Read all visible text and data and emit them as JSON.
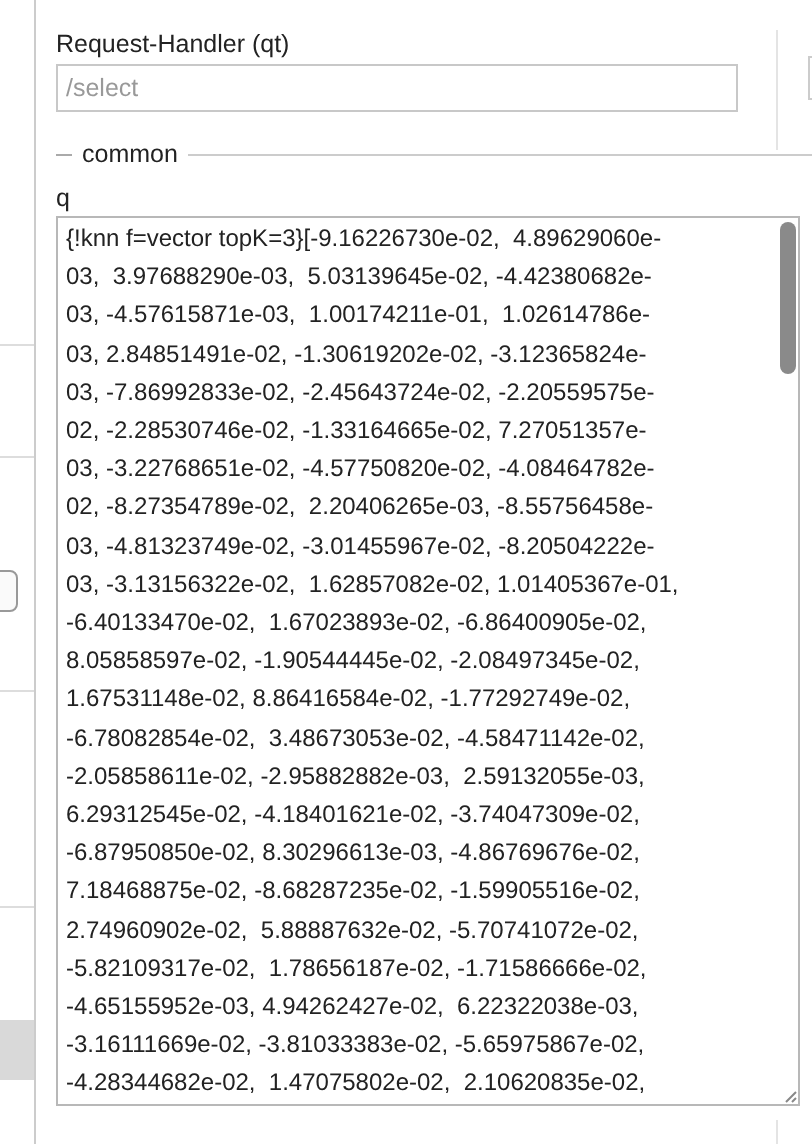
{
  "request_handler": {
    "label": "Request-Handler (qt)",
    "placeholder": "/select"
  },
  "section": {
    "title": "common"
  },
  "q": {
    "label": "q",
    "lines": [
      "{!knn f=vector topK=3}[-9.16226730e-02,  4.89629060e-",
      "03,  3.97688290e-03,  5.03139645e-02, -4.42380682e-",
      "03, -4.57615871e-03,  1.00174211e-01,  1.02614786e-",
      "03, 2.84851491e-02, -1.30619202e-02, -3.12365824e-",
      "03, -7.86992833e-02, -2.45643724e-02, -2.20559575e-",
      "02, -2.28530746e-02, -1.33164665e-02, 7.27051357e-",
      "03, -3.22768651e-02, -4.57750820e-02, -4.08464782e-",
      "02, -8.27354789e-02,  2.20406265e-03, -8.55756458e-",
      "03, -4.81323749e-02, -3.01455967e-02, -8.20504222e-",
      "03, -3.13156322e-02,  1.62857082e-02, 1.01405367e-01,",
      "-6.40133470e-02,  1.67023893e-02, -6.86400905e-02,",
      "8.05858597e-02, -1.90544445e-02, -2.08497345e-02,",
      "1.67531148e-02, 8.86416584e-02, -1.77292749e-02,",
      "-6.78082854e-02,  3.48673053e-02, -4.58471142e-02,",
      "-2.05858611e-02, -2.95882882e-03,  2.59132055e-03,",
      "6.29312545e-02, -4.18401621e-02, -3.74047309e-02,",
      "-6.87950850e-02, 8.30296613e-03, -4.86769676e-02,",
      "7.18468875e-02, -8.68287235e-02, -1.59905516e-02,",
      "2.74960902e-02,  5.88887632e-02, -5.70741072e-02,",
      "-5.82109317e-02,  1.78656187e-02, -1.71586666e-02,",
      "-4.65155952e-03, 4.94262427e-02,  6.22322038e-03,",
      "-3.16111669e-02, -3.81033383e-02, -5.65975867e-02,",
      "-4.28344682e-02,  1.47075802e-02,  2.10620835e-02,"
    ]
  }
}
